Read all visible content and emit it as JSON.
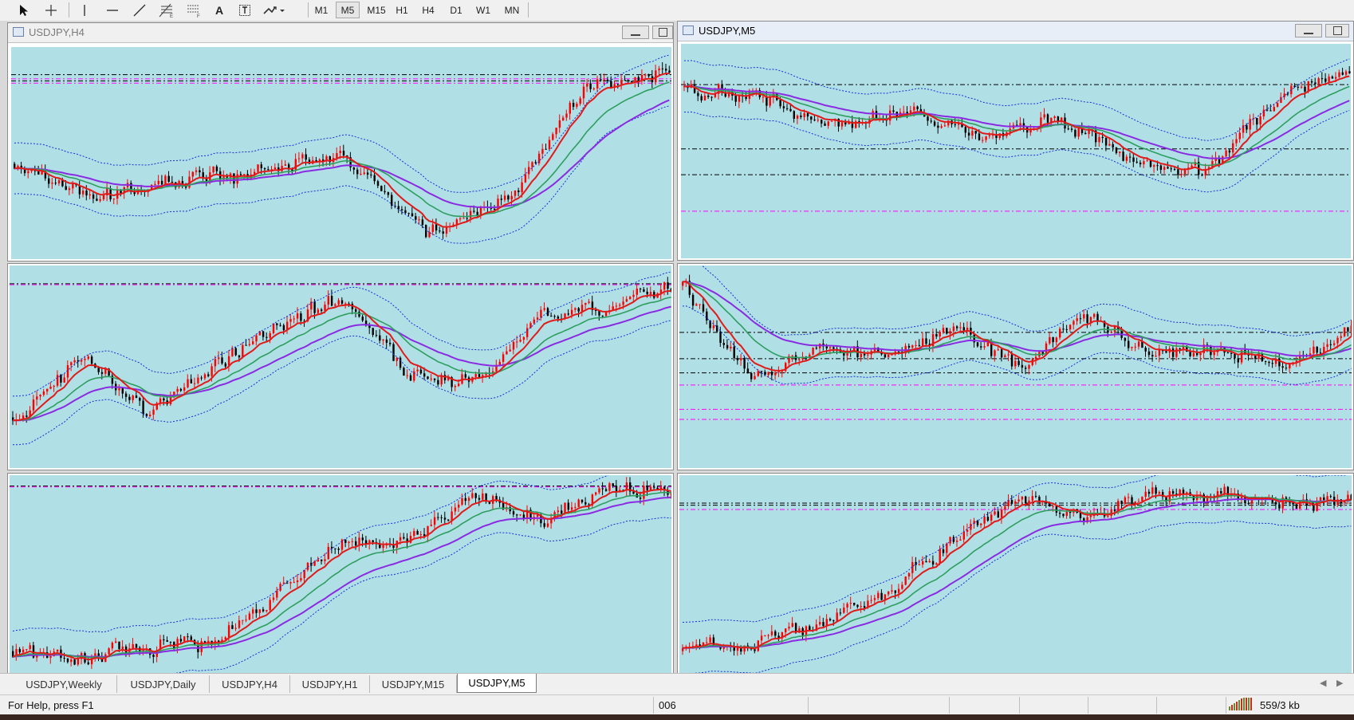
{
  "toolbar": {
    "timeframes": [
      "M1",
      "M5",
      "M15",
      "H1",
      "H4",
      "D1",
      "W1",
      "MN"
    ],
    "text_tool_label": "A",
    "active_timeframe": "M5"
  },
  "charts": [
    {
      "id": "tl",
      "title": "USDJPY,H4",
      "active": false
    },
    {
      "id": "tr",
      "title": "USDJPY,M5",
      "active": true
    }
  ],
  "tabs": [
    "USDJPY,Weekly",
    "USDJPY,Daily",
    "USDJPY,H4",
    "USDJPY,H1",
    "USDJPY,M15",
    "USDJPY,M5"
  ],
  "active_tab": "USDJPY,M5",
  "status": {
    "help": "For Help, press F1",
    "profile": "006",
    "traffic": "559/3 kb"
  },
  "colors": {
    "chart_bg": "#b0e0e6",
    "bull_candle": "#ff0000",
    "bear_candle": "#000000",
    "ema_fast": "#e11a1a",
    "ema_mid": "#2e9e5e",
    "ema_slow": "#8a2be2",
    "bands": "#1530d8",
    "level_line": "#000000",
    "level_line_magenta": "#ff00ff"
  },
  "icons": [
    "cursor-arrow-icon",
    "crosshair-icon",
    "vertical-line-icon",
    "horizontal-line-icon",
    "trend-line-icon",
    "fibonacci-icon",
    "fibonacci-fan-icon",
    "text-icon",
    "text-label-icon",
    "arrow-shapes-icon",
    "chart-window-icon",
    "minimize-icon",
    "maximize-icon"
  ]
}
